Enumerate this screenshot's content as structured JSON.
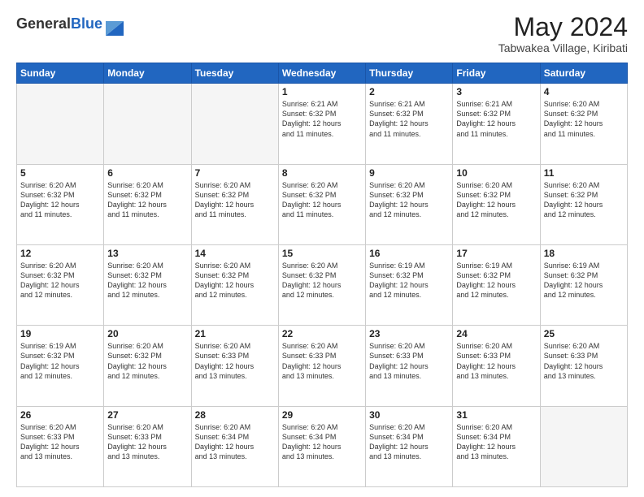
{
  "header": {
    "logo_general": "General",
    "logo_blue": "Blue",
    "month_year": "May 2024",
    "location": "Tabwakea Village, Kiribati"
  },
  "weekdays": [
    "Sunday",
    "Monday",
    "Tuesday",
    "Wednesday",
    "Thursday",
    "Friday",
    "Saturday"
  ],
  "weeks": [
    [
      {
        "day": "",
        "info": ""
      },
      {
        "day": "",
        "info": ""
      },
      {
        "day": "",
        "info": ""
      },
      {
        "day": "1",
        "info": "Sunrise: 6:21 AM\nSunset: 6:32 PM\nDaylight: 12 hours\nand 11 minutes."
      },
      {
        "day": "2",
        "info": "Sunrise: 6:21 AM\nSunset: 6:32 PM\nDaylight: 12 hours\nand 11 minutes."
      },
      {
        "day": "3",
        "info": "Sunrise: 6:21 AM\nSunset: 6:32 PM\nDaylight: 12 hours\nand 11 minutes."
      },
      {
        "day": "4",
        "info": "Sunrise: 6:20 AM\nSunset: 6:32 PM\nDaylight: 12 hours\nand 11 minutes."
      }
    ],
    [
      {
        "day": "5",
        "info": "Sunrise: 6:20 AM\nSunset: 6:32 PM\nDaylight: 12 hours\nand 11 minutes."
      },
      {
        "day": "6",
        "info": "Sunrise: 6:20 AM\nSunset: 6:32 PM\nDaylight: 12 hours\nand 11 minutes."
      },
      {
        "day": "7",
        "info": "Sunrise: 6:20 AM\nSunset: 6:32 PM\nDaylight: 12 hours\nand 11 minutes."
      },
      {
        "day": "8",
        "info": "Sunrise: 6:20 AM\nSunset: 6:32 PM\nDaylight: 12 hours\nand 11 minutes."
      },
      {
        "day": "9",
        "info": "Sunrise: 6:20 AM\nSunset: 6:32 PM\nDaylight: 12 hours\nand 12 minutes."
      },
      {
        "day": "10",
        "info": "Sunrise: 6:20 AM\nSunset: 6:32 PM\nDaylight: 12 hours\nand 12 minutes."
      },
      {
        "day": "11",
        "info": "Sunrise: 6:20 AM\nSunset: 6:32 PM\nDaylight: 12 hours\nand 12 minutes."
      }
    ],
    [
      {
        "day": "12",
        "info": "Sunrise: 6:20 AM\nSunset: 6:32 PM\nDaylight: 12 hours\nand 12 minutes."
      },
      {
        "day": "13",
        "info": "Sunrise: 6:20 AM\nSunset: 6:32 PM\nDaylight: 12 hours\nand 12 minutes."
      },
      {
        "day": "14",
        "info": "Sunrise: 6:20 AM\nSunset: 6:32 PM\nDaylight: 12 hours\nand 12 minutes."
      },
      {
        "day": "15",
        "info": "Sunrise: 6:20 AM\nSunset: 6:32 PM\nDaylight: 12 hours\nand 12 minutes."
      },
      {
        "day": "16",
        "info": "Sunrise: 6:19 AM\nSunset: 6:32 PM\nDaylight: 12 hours\nand 12 minutes."
      },
      {
        "day": "17",
        "info": "Sunrise: 6:19 AM\nSunset: 6:32 PM\nDaylight: 12 hours\nand 12 minutes."
      },
      {
        "day": "18",
        "info": "Sunrise: 6:19 AM\nSunset: 6:32 PM\nDaylight: 12 hours\nand 12 minutes."
      }
    ],
    [
      {
        "day": "19",
        "info": "Sunrise: 6:19 AM\nSunset: 6:32 PM\nDaylight: 12 hours\nand 12 minutes."
      },
      {
        "day": "20",
        "info": "Sunrise: 6:20 AM\nSunset: 6:32 PM\nDaylight: 12 hours\nand 12 minutes."
      },
      {
        "day": "21",
        "info": "Sunrise: 6:20 AM\nSunset: 6:33 PM\nDaylight: 12 hours\nand 13 minutes."
      },
      {
        "day": "22",
        "info": "Sunrise: 6:20 AM\nSunset: 6:33 PM\nDaylight: 12 hours\nand 13 minutes."
      },
      {
        "day": "23",
        "info": "Sunrise: 6:20 AM\nSunset: 6:33 PM\nDaylight: 12 hours\nand 13 minutes."
      },
      {
        "day": "24",
        "info": "Sunrise: 6:20 AM\nSunset: 6:33 PM\nDaylight: 12 hours\nand 13 minutes."
      },
      {
        "day": "25",
        "info": "Sunrise: 6:20 AM\nSunset: 6:33 PM\nDaylight: 12 hours\nand 13 minutes."
      }
    ],
    [
      {
        "day": "26",
        "info": "Sunrise: 6:20 AM\nSunset: 6:33 PM\nDaylight: 12 hours\nand 13 minutes."
      },
      {
        "day": "27",
        "info": "Sunrise: 6:20 AM\nSunset: 6:33 PM\nDaylight: 12 hours\nand 13 minutes."
      },
      {
        "day": "28",
        "info": "Sunrise: 6:20 AM\nSunset: 6:34 PM\nDaylight: 12 hours\nand 13 minutes."
      },
      {
        "day": "29",
        "info": "Sunrise: 6:20 AM\nSunset: 6:34 PM\nDaylight: 12 hours\nand 13 minutes."
      },
      {
        "day": "30",
        "info": "Sunrise: 6:20 AM\nSunset: 6:34 PM\nDaylight: 12 hours\nand 13 minutes."
      },
      {
        "day": "31",
        "info": "Sunrise: 6:20 AM\nSunset: 6:34 PM\nDaylight: 12 hours\nand 13 minutes."
      },
      {
        "day": "",
        "info": ""
      }
    ]
  ]
}
